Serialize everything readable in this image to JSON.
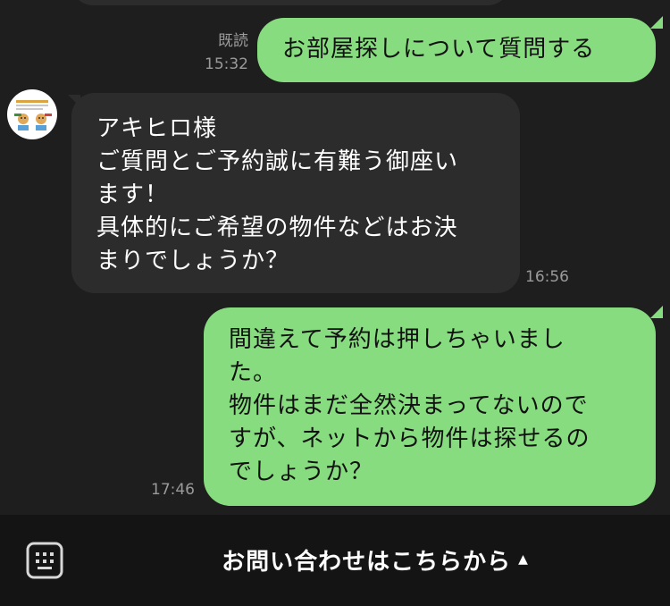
{
  "messages": [
    {
      "id": "m1",
      "direction": "out",
      "read_label": "既読",
      "time": "15:32",
      "text": "お部屋探しについて質問する"
    },
    {
      "id": "m2",
      "direction": "in",
      "time": "16:56",
      "text": "アキヒロ様\nご質問とご予約誠に有難う御座い\nます！\n具体的にご希望の物件などはお決\nまりでしょうか？"
    },
    {
      "id": "m3",
      "direction": "out",
      "time": "17:46",
      "text": "間違えて予約は押しちゃいまし\nた。\n物件はまだ全然決まってないので\nすが、ネットから物件は探せるの\nでしょうか？"
    }
  ],
  "footer": {
    "menu_label": "お問い合わせはこちらから",
    "caret": "▲",
    "keyboard_icon": "keyboard-icon"
  },
  "colors": {
    "background": "#1e1e1e",
    "incoming_bubble": "#2c2c2c",
    "outgoing_bubble": "#86dc7e",
    "footer_background": "#141414",
    "meta_text": "#9a9a9a"
  }
}
